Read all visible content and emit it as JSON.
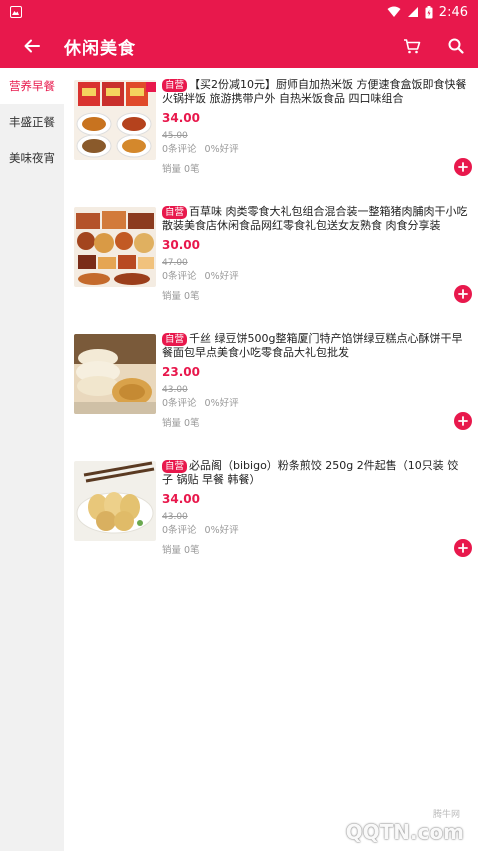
{
  "status_bar": {
    "time": "2:46"
  },
  "header": {
    "title": "休闲美食"
  },
  "sidebar": {
    "items": [
      {
        "label": "营养早餐",
        "active": true
      },
      {
        "label": "丰盛正餐",
        "active": false
      },
      {
        "label": "美味夜宵",
        "active": false
      }
    ]
  },
  "products": [
    {
      "badge": "自营",
      "name": "【买2份减10元】厨师自加热米饭 方便速食盒饭即食快餐火锅拌饭 旅游携带户外 自热米饭食品 四口味组合",
      "price": "34.00",
      "old_price": "45.00",
      "reviews": "0条评论",
      "rating": "0%好评",
      "sales": "销量 0笔"
    },
    {
      "badge": "自营",
      "name": "百草味 肉类零食大礼包组合混合装一整箱猪肉脯肉干小吃散装美食店休闲食品网红零食礼包送女友熟食 肉食分享装",
      "price": "30.00",
      "old_price": "47.00",
      "reviews": "0条评论",
      "rating": "0%好评",
      "sales": "销量 0笔"
    },
    {
      "badge": "自营",
      "name": "千丝 绿豆饼500g整箱厦门特产馅饼绿豆糕点心酥饼干早餐面包早点美食小吃零食品大礼包批发",
      "price": "23.00",
      "old_price": "43.00",
      "reviews": "0条评论",
      "rating": "0%好评",
      "sales": "销量 0笔"
    },
    {
      "badge": "自营",
      "name": "必品阁（bibigo）粉条煎饺 250g 2件起售（10只装 饺子 锅贴 早餐 韩餐）",
      "price": "34.00",
      "old_price": "43.00",
      "reviews": "0条评论",
      "rating": "0%好评",
      "sales": "销量 0笔"
    }
  ],
  "watermark": {
    "text": "QQTN.com",
    "small": "腾牛网"
  },
  "colors": {
    "accent": "#e8184c",
    "sidebar_bg": "#f1f1f1"
  }
}
